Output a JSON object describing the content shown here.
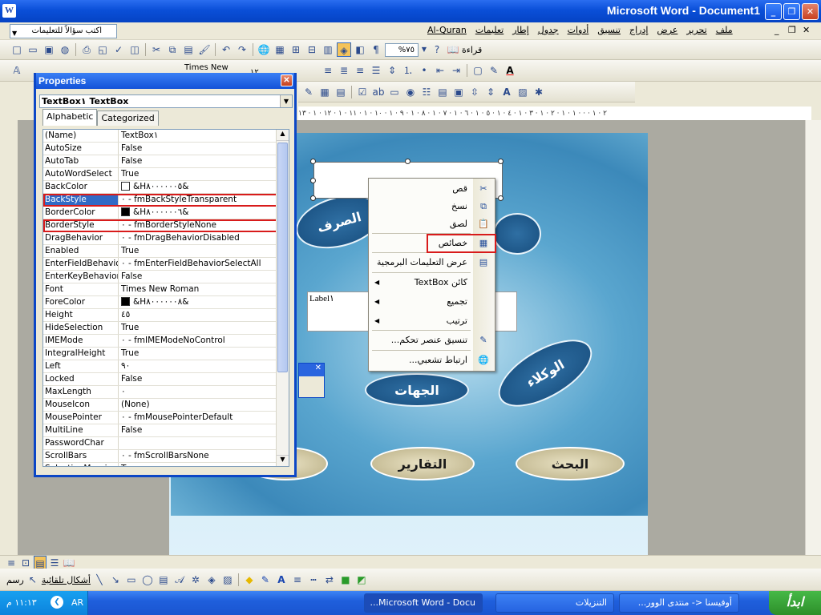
{
  "window": {
    "title": "Microsoft Word - Document1",
    "app_icon": "W",
    "min": "_",
    "max": "❐",
    "close": "✕"
  },
  "menubar": {
    "ask_placeholder": "اكتب سؤالاً للتعليمات",
    "menus": [
      "ملف",
      "تحرير",
      "عرض",
      "إدراج",
      "تنسيق",
      "أدوات",
      "جدول",
      "إطار",
      "تعليمات",
      "Al-Quran"
    ],
    "mdi_buttons": [
      "_",
      "❐",
      "✕"
    ]
  },
  "toolbar": {
    "zoom": "%٧٥",
    "read_label": "قراءة",
    "font_name": "Times New Roman",
    "font_size": "١٢"
  },
  "ruler": {
    "numbers": "٢ · ١ · · · ١ · ١ · ٢ · ١ · ٣ · ١ · ٤ · ١ · ٥ · ١ · ٦ · ١ · ٧ · ١ · ٨ · ١ · ٩ · ١ · ١٠ · ١ · ١١ · ١ · ١٢ · ١ · ١٣"
  },
  "document": {
    "ovals": [
      "الصرف",
      "الوكلاء",
      "الجهات",
      "التقارير",
      "البحث"
    ],
    "label_control": "Label١"
  },
  "properties": {
    "title": "Properties",
    "object": "TextBox١  TextBox",
    "tabs": [
      "Alphabetic",
      "Categorized"
    ],
    "rows": [
      {
        "name": "(Name)",
        "value": "TextBox١"
      },
      {
        "name": "AutoSize",
        "value": "False"
      },
      {
        "name": "AutoTab",
        "value": "False"
      },
      {
        "name": "AutoWordSelect",
        "value": "True"
      },
      {
        "name": "BackColor",
        "value": "&H٨٠٠٠٠٠٠٥&",
        "swatch": "#ffffff"
      },
      {
        "name": "BackStyle",
        "value": "٠ - fmBackStyleTransparent",
        "selected": true,
        "boxed": true
      },
      {
        "name": "BorderColor",
        "value": "&H٨٠٠٠٠٠٠٦&",
        "swatch": "#000000"
      },
      {
        "name": "BorderStyle",
        "value": "٠ - fmBorderStyleNone",
        "boxed": true
      },
      {
        "name": "DragBehavior",
        "value": "٠ - fmDragBehaviorDisabled"
      },
      {
        "name": "Enabled",
        "value": "True"
      },
      {
        "name": "EnterFieldBehavior",
        "value": "٠ - fmEnterFieldBehaviorSelectAll"
      },
      {
        "name": "EnterKeyBehavior",
        "value": "False"
      },
      {
        "name": "Font",
        "value": "Times New Roman"
      },
      {
        "name": "ForeColor",
        "value": "&H٨٠٠٠٠٠٠٨&",
        "swatch": "#000000"
      },
      {
        "name": "Height",
        "value": "٤٥"
      },
      {
        "name": "HideSelection",
        "value": "True"
      },
      {
        "name": "IMEMode",
        "value": "٠ - fmIMEModeNoControl"
      },
      {
        "name": "IntegralHeight",
        "value": "True"
      },
      {
        "name": "Left",
        "value": "٩٠"
      },
      {
        "name": "Locked",
        "value": "False"
      },
      {
        "name": "MaxLength",
        "value": "٠"
      },
      {
        "name": "MouseIcon",
        "value": "(None)"
      },
      {
        "name": "MousePointer",
        "value": "٠ - fmMousePointerDefault"
      },
      {
        "name": "MultiLine",
        "value": "False"
      },
      {
        "name": "PasswordChar",
        "value": ""
      },
      {
        "name": "ScrollBars",
        "value": "٠ - fmScrollBarsNone"
      },
      {
        "name": "SelectionMargin",
        "value": "True"
      }
    ]
  },
  "context_menu": {
    "items": [
      {
        "label": "قص",
        "icon": "✂",
        "name": "cut"
      },
      {
        "label": "نسخ",
        "icon": "⧉",
        "name": "copy"
      },
      {
        "label": "لصق",
        "icon": "📋",
        "name": "paste"
      },
      {
        "label": "خصائص",
        "icon": "▦",
        "name": "properties"
      },
      {
        "label": "عرض التعليمات البرمجية",
        "icon": "▤",
        "name": "view-code"
      },
      {
        "label": "كائن TextBox",
        "icon": "",
        "name": "textbox-object",
        "submenu": true
      },
      {
        "label": "تجميع",
        "icon": "",
        "name": "group",
        "submenu": true
      },
      {
        "label": "ترتيب",
        "icon": "",
        "name": "order",
        "submenu": true
      },
      {
        "label": "تنسيق عنصر تحكم...",
        "icon": "✎",
        "name": "format-control"
      },
      {
        "label": "ارتباط تشعبي...",
        "icon": "🌐",
        "name": "hyperlink"
      }
    ]
  },
  "drawbar": {
    "draw": "رسم",
    "autoshapes": "أشكال تلقائية"
  },
  "taskbar": {
    "start": "ابدأ",
    "tasks": [
      "أوفيسنا <- منتدى الوور...",
      "التنزيلات",
      "Microsoft Word - Docu..."
    ],
    "lang": "AR",
    "clock": "١١:١٣ م"
  },
  "colors": {
    "accent": "#0c47c6",
    "highlight": "#d81b1b",
    "selection": "#316ac5"
  }
}
